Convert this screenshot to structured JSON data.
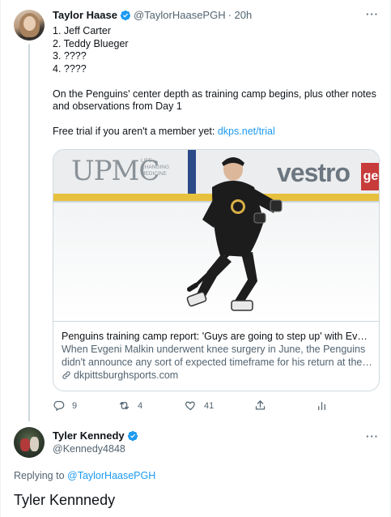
{
  "colors": {
    "accent": "#1d9bf0",
    "text": "#0f1419",
    "muted": "#536471",
    "border": "#cfd9de"
  },
  "tweet": {
    "author_name": "Taylor Haase",
    "author_handle": "@TaylorHaasePGH",
    "time": "· 20h",
    "more_icon": "more-icon",
    "lines": [
      "1. Jeff Carter",
      "2. Teddy Blueger",
      "3. ????",
      "4. ????"
    ],
    "paragraph": [
      "On the Penguins' center depth as training camp begins, plus other notes",
      "and observations from Day 1"
    ],
    "trial_prefix": "Free trial if you aren't a member yet: ",
    "trial_link": "dkps.net/trial"
  },
  "card": {
    "image_signs": {
      "upmc": "UPMC",
      "upmc_sub": [
        "LIFE",
        "CHANGING",
        "MEDICINE"
      ],
      "vestro": "vestro",
      "ge": "ge"
    },
    "title": "Penguins training camp report: 'Guys are going to step up' with Evgeni…",
    "desc": [
      "When Evgeni Malkin underwent knee surgery in June, the Penguins",
      "didn't announce any sort of expected timeframe for his return at the …"
    ],
    "domain": "dkpittsburghsports.com"
  },
  "actions": {
    "reply_count": "9",
    "retweet_count": "4",
    "like_count": "41"
  },
  "reply_tweet": {
    "author_name": "Tyler Kennedy",
    "author_handle": "@Kennedy4848",
    "replying_prefix": "Replying to ",
    "replying_handle": "@TaylorHaasePGH",
    "text": "Tyler Kennnedy"
  }
}
